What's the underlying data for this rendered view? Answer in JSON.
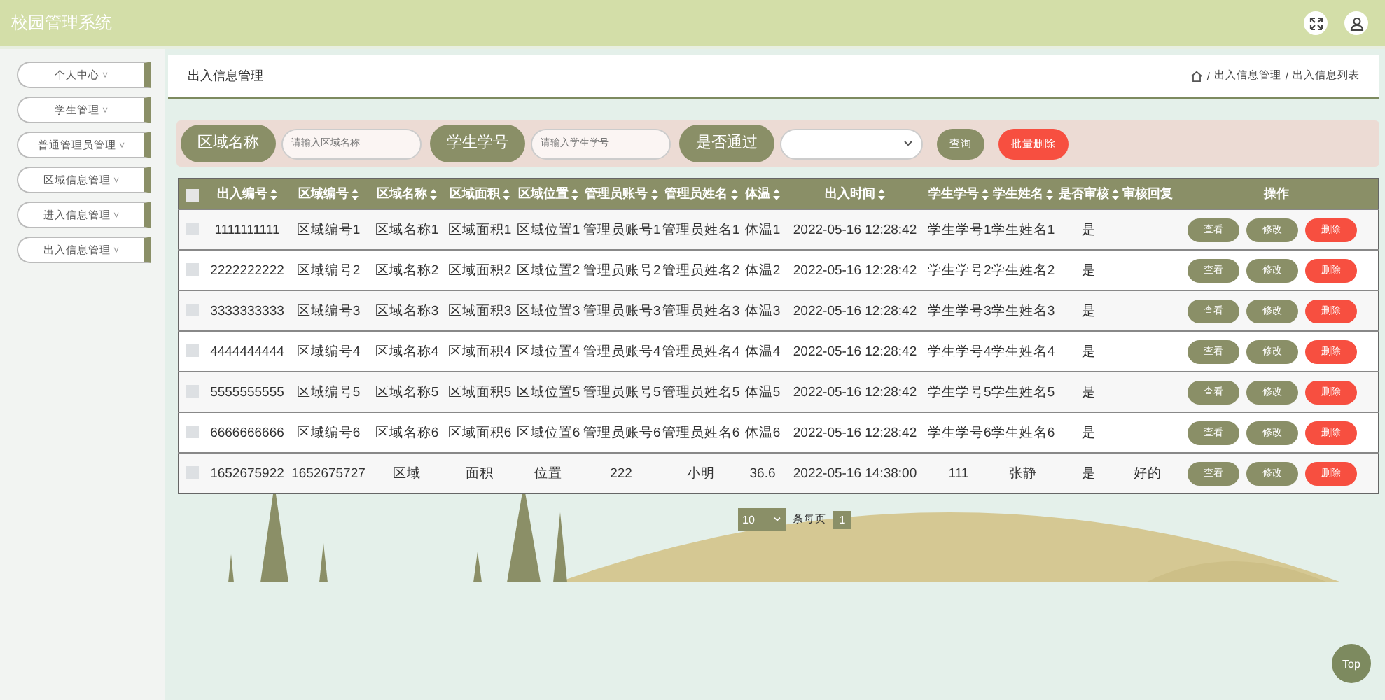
{
  "header": {
    "title": "校园管理系统"
  },
  "sidebar": {
    "items": [
      {
        "label": "个人中心",
        "caret": "˅"
      },
      {
        "label": "学生管理",
        "caret": "˅"
      },
      {
        "label": "普通管理员管理",
        "caret": "˅"
      },
      {
        "label": "区域信息管理",
        "caret": "˅"
      },
      {
        "label": "进入信息管理",
        "caret": "˅"
      },
      {
        "label": "出入信息管理",
        "caret": "˅"
      }
    ]
  },
  "page": {
    "title": "出入信息管理",
    "breadcrumb_separator": "/",
    "breadcrumbs": [
      "出入信息管理",
      "出入信息列表"
    ]
  },
  "search": {
    "fields": [
      {
        "kind": "text",
        "label": "区域名称",
        "placeholder": "请输入区域名称"
      },
      {
        "kind": "text",
        "label": "学生学号",
        "placeholder": "请输入学生学号"
      },
      {
        "kind": "select",
        "label": "是否通过"
      }
    ],
    "buttons": [
      {
        "label": "查询",
        "kind": "normal"
      },
      {
        "label": "批量删除",
        "kind": "danger"
      }
    ]
  },
  "table": {
    "all_checked": false,
    "columns": [
      {
        "label": "出入编号",
        "sortable": true
      },
      {
        "label": "区域编号",
        "sortable": true
      },
      {
        "label": "区域名称",
        "sortable": true
      },
      {
        "label": "区域面积",
        "sortable": true
      },
      {
        "label": "区域位置",
        "sortable": true
      },
      {
        "label": "管理员账号",
        "sortable": true
      },
      {
        "label": "管理员姓名",
        "sortable": true
      },
      {
        "label": "体温",
        "sortable": true
      },
      {
        "label": "出入时间",
        "sortable": true
      },
      {
        "label": "学生学号",
        "sortable": true
      },
      {
        "label": "学生姓名",
        "sortable": true
      },
      {
        "label": "是否审核",
        "sortable": true
      },
      {
        "label": "审核回复",
        "sortable": false
      },
      {
        "label": "操作",
        "sortable": false
      }
    ],
    "rows": [
      {
        "checked": false,
        "cells": [
          "1111111111",
          "区域编号1",
          "区域名称1",
          "区域面积1",
          "区域位置1",
          "管理员账号1",
          "管理员姓名1",
          "体温1",
          "2022-05-16 12:28:42",
          "学生学号1",
          "学生姓名1",
          "是",
          ""
        ],
        "actions": [
          {
            "label": "查看",
            "kind": "normal"
          },
          {
            "label": "修改",
            "kind": "normal"
          },
          {
            "label": "删除",
            "kind": "danger"
          }
        ]
      },
      {
        "checked": false,
        "cells": [
          "2222222222",
          "区域编号2",
          "区域名称2",
          "区域面积2",
          "区域位置2",
          "管理员账号2",
          "管理员姓名2",
          "体温2",
          "2022-05-16 12:28:42",
          "学生学号2",
          "学生姓名2",
          "是",
          ""
        ],
        "actions": [
          {
            "label": "查看",
            "kind": "normal"
          },
          {
            "label": "修改",
            "kind": "normal"
          },
          {
            "label": "删除",
            "kind": "danger"
          }
        ]
      },
      {
        "checked": false,
        "cells": [
          "3333333333",
          "区域编号3",
          "区域名称3",
          "区域面积3",
          "区域位置3",
          "管理员账号3",
          "管理员姓名3",
          "体温3",
          "2022-05-16 12:28:42",
          "学生学号3",
          "学生姓名3",
          "是",
          ""
        ],
        "actions": [
          {
            "label": "查看",
            "kind": "normal"
          },
          {
            "label": "修改",
            "kind": "normal"
          },
          {
            "label": "删除",
            "kind": "danger"
          }
        ]
      },
      {
        "checked": false,
        "cells": [
          "4444444444",
          "区域编号4",
          "区域名称4",
          "区域面积4",
          "区域位置4",
          "管理员账号4",
          "管理员姓名4",
          "体温4",
          "2022-05-16 12:28:42",
          "学生学号4",
          "学生姓名4",
          "是",
          ""
        ],
        "actions": [
          {
            "label": "查看",
            "kind": "normal"
          },
          {
            "label": "修改",
            "kind": "normal"
          },
          {
            "label": "删除",
            "kind": "danger"
          }
        ]
      },
      {
        "checked": false,
        "cells": [
          "5555555555",
          "区域编号5",
          "区域名称5",
          "区域面积5",
          "区域位置5",
          "管理员账号5",
          "管理员姓名5",
          "体温5",
          "2022-05-16 12:28:42",
          "学生学号5",
          "学生姓名5",
          "是",
          ""
        ],
        "actions": [
          {
            "label": "查看",
            "kind": "normal"
          },
          {
            "label": "修改",
            "kind": "normal"
          },
          {
            "label": "删除",
            "kind": "danger"
          }
        ]
      },
      {
        "checked": false,
        "cells": [
          "6666666666",
          "区域编号6",
          "区域名称6",
          "区域面积6",
          "区域位置6",
          "管理员账号6",
          "管理员姓名6",
          "体温6",
          "2022-05-16 12:28:42",
          "学生学号6",
          "学生姓名6",
          "是",
          ""
        ],
        "actions": [
          {
            "label": "查看",
            "kind": "normal"
          },
          {
            "label": "修改",
            "kind": "normal"
          },
          {
            "label": "删除",
            "kind": "danger"
          }
        ]
      },
      {
        "checked": false,
        "cells": [
          "1652675922",
          "1652675727",
          "区域",
          "面积",
          "位置",
          "222",
          "小明",
          "36.6",
          "2022-05-16 14:38:00",
          "111",
          "张静",
          "是",
          "好的"
        ],
        "actions": [
          {
            "label": "查看",
            "kind": "normal"
          },
          {
            "label": "修改",
            "kind": "normal"
          },
          {
            "label": "删除",
            "kind": "danger"
          }
        ]
      }
    ]
  },
  "pagination": {
    "page_size": "10",
    "page_size_label": "条每页",
    "pages": [
      {
        "label": "1",
        "selected": true
      }
    ]
  },
  "back_to_top": {
    "label": "Top"
  }
}
